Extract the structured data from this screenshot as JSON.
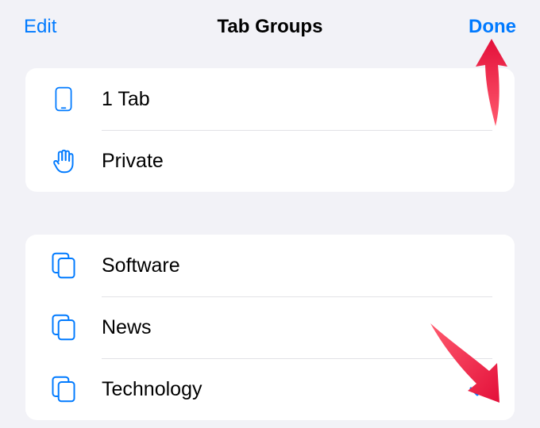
{
  "header": {
    "edit_label": "Edit",
    "title": "Tab Groups",
    "done_label": "Done"
  },
  "colors": {
    "tint": "#007aff",
    "arrow": "#e3103a"
  },
  "sections": [
    {
      "rows": [
        {
          "icon": "iphone-icon",
          "label": "1 Tab",
          "selected": false
        },
        {
          "icon": "hand-icon",
          "label": "Private",
          "selected": false
        }
      ]
    },
    {
      "rows": [
        {
          "icon": "stack-icon",
          "label": "Software",
          "selected": false
        },
        {
          "icon": "stack-icon",
          "label": "News",
          "selected": false
        },
        {
          "icon": "stack-icon",
          "label": "Technology",
          "selected": true
        }
      ]
    }
  ],
  "annotations": {
    "arrow1_target": "done-button",
    "arrow2_target": "checkmark"
  }
}
